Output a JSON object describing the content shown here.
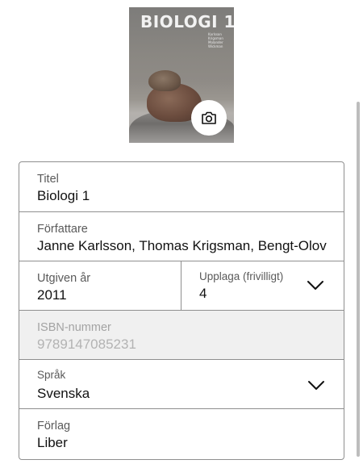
{
  "cover": {
    "title": "BIOLOGI 1",
    "authors": [
      "Karlsson",
      "Krigsman",
      "Molander",
      "Wickman"
    ],
    "camera_icon": "camera-icon"
  },
  "form": {
    "title": {
      "label": "Titel",
      "value": "Biologi 1"
    },
    "authors": {
      "label": "Författare",
      "value": "Janne Karlsson, Thomas Krigsman, Bengt-Olov Molander, Lena Wickman"
    },
    "year": {
      "label": "Utgiven år",
      "value": "2011"
    },
    "edition": {
      "label": "Upplaga (frivilligt)",
      "value": "4",
      "icon": "chevron-down-icon"
    },
    "isbn": {
      "label": "ISBN-nummer",
      "value": "9789147085231"
    },
    "language": {
      "label": "Språk",
      "value": "Svenska",
      "icon": "chevron-down-icon"
    },
    "publisher": {
      "label": "Förlag",
      "value": "Liber"
    }
  }
}
